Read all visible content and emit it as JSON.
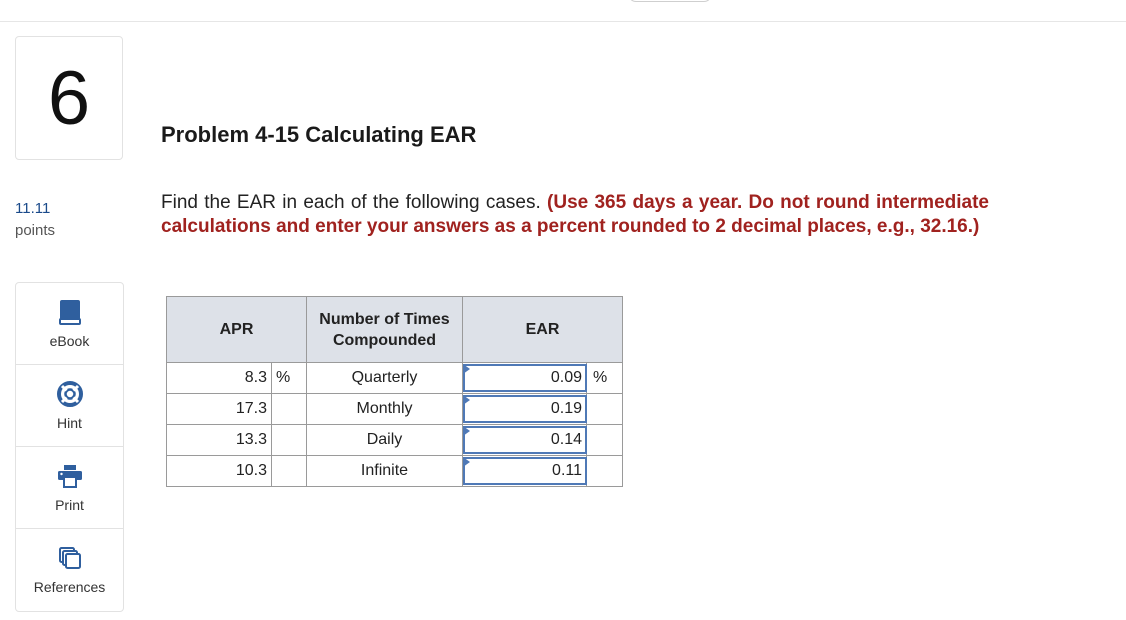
{
  "question": {
    "number": "6",
    "points_value": "11.11",
    "points_label": "points"
  },
  "tools": [
    {
      "label": "eBook",
      "icon": "book-icon"
    },
    {
      "label": "Hint",
      "icon": "lifebuoy-icon"
    },
    {
      "label": "Print",
      "icon": "printer-icon"
    },
    {
      "label": "References",
      "icon": "copy-icon"
    }
  ],
  "problem": {
    "title": "Problem 4-15 Calculating EAR",
    "instruction": "Find the EAR in each of the following cases.",
    "note": "(Use 365 days a year. Do not round intermediate calculations and enter your answers as a percent rounded to 2 decimal places, e.g., 32.16.)"
  },
  "table": {
    "headers": {
      "apr": "APR",
      "compounded": "Number of Times Compounded",
      "ear": "EAR"
    },
    "rows": [
      {
        "apr": "8.3",
        "apr_unit": "%",
        "compounded": "Quarterly",
        "ear": "0.09",
        "ear_unit": "%"
      },
      {
        "apr": "17.3",
        "apr_unit": "",
        "compounded": "Monthly",
        "ear": "0.19",
        "ear_unit": ""
      },
      {
        "apr": "13.3",
        "apr_unit": "",
        "compounded": "Daily",
        "ear": "0.14",
        "ear_unit": ""
      },
      {
        "apr": "10.3",
        "apr_unit": "",
        "compounded": "Infinite",
        "ear": "0.11",
        "ear_unit": ""
      }
    ]
  },
  "colors": {
    "accent_red": "#a0221f",
    "input_border": "#4f79b6",
    "header_bg": "#dde1e8",
    "icon_blue": "#2f5f9e"
  }
}
